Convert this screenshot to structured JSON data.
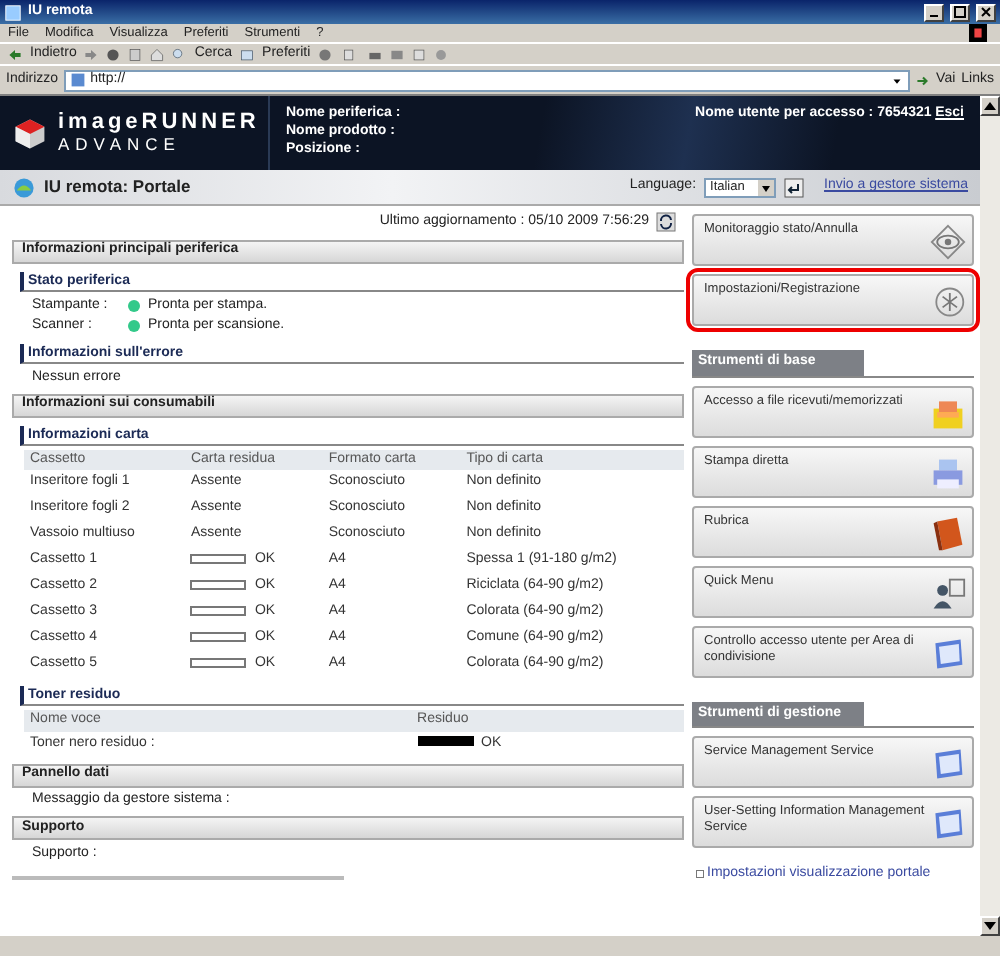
{
  "window": {
    "title": "IU remota"
  },
  "menu": [
    "File",
    "Modifica",
    "Visualizza",
    "Preferiti",
    "Strumenti",
    "?"
  ],
  "toolbar": {
    "back": "Indietro",
    "search": "Cerca",
    "favorites": "Preferiti"
  },
  "address": {
    "label": "Indirizzo",
    "value": "http://",
    "go": "Vai",
    "links": "Links"
  },
  "header": {
    "product": "imageRUNNER",
    "product_line": "ADVANCE",
    "fields": [
      "Nome periferica :",
      "Nome prodotto :",
      "Posizione :"
    ],
    "user": "Nome utente per accesso : 7654321",
    "logout": "Esci"
  },
  "subheader": {
    "title": "IU remota: Portale",
    "language_label": "Language:",
    "language": "Italian",
    "admin_link": "Invio a gestore sistema"
  },
  "last_update": "Ultimo aggiornamento : 05/10 2009 7:56:29",
  "device_info": {
    "title": "Informazioni principali periferica",
    "status": {
      "title": "Stato periferica",
      "items": [
        {
          "label": "Stampante :",
          "text": "Pronta per stampa.",
          "color": "#33c98a"
        },
        {
          "label": "Scanner :",
          "text": "Pronta per scansione.",
          "color": "#33c98a"
        }
      ]
    },
    "errors": {
      "title": "Informazioni sull'errore",
      "text": "Nessun errore"
    }
  },
  "consumables": {
    "title": "Informazioni sui consumabili",
    "paper": {
      "title": "Informazioni carta",
      "columns": [
        "Cassetto",
        "Carta residua",
        "Formato carta",
        "Tipo di carta"
      ],
      "rows": [
        {
          "kind": "text",
          "source": "Inseritore fogli 1",
          "remaining": "Assente",
          "size": "Sconosciuto",
          "type": "Non definito"
        },
        {
          "kind": "text",
          "source": "Inseritore fogli 2",
          "remaining": "Assente",
          "size": "Sconosciuto",
          "type": "Non definito"
        },
        {
          "kind": "text",
          "source": "Vassoio multiuso",
          "remaining": "Assente",
          "size": "Sconosciuto",
          "type": "Non definito"
        },
        {
          "kind": "meter",
          "source": "Cassetto 1",
          "level": 0,
          "remaining": "OK",
          "size": "A4",
          "type": "Spessa 1 (91-180 g/m2)"
        },
        {
          "kind": "meter",
          "source": "Cassetto 2",
          "level": 0,
          "remaining": "OK",
          "size": "A4",
          "type": "Riciclata (64-90 g/m2)"
        },
        {
          "kind": "meter",
          "source": "Cassetto 3",
          "level": 0,
          "remaining": "OK",
          "size": "A4",
          "type": "Colorata (64-90 g/m2)"
        },
        {
          "kind": "meter",
          "source": "Cassetto 4",
          "level": 0,
          "remaining": "OK",
          "size": "A4",
          "type": "Comune (64-90 g/m2)"
        },
        {
          "kind": "meter",
          "source": "Cassetto 5",
          "level": 0,
          "remaining": "OK",
          "size": "A4",
          "type": "Colorata (64-90 g/m2)"
        }
      ]
    },
    "toner": {
      "title": "Toner residuo",
      "columns": [
        "Nome voce",
        "Residuo"
      ],
      "rows": [
        {
          "name": "Toner nero residuo :",
          "level": 1,
          "remaining": "OK"
        }
      ]
    }
  },
  "data_panel": {
    "title": "Pannello dati",
    "text": "Messaggio da gestore sistema :"
  },
  "support": {
    "title": "Supporto",
    "text": "Supporto :"
  },
  "side": {
    "top_buttons": [
      {
        "label": "Monitoraggio stato/Annulla",
        "kind": "eye",
        "highlighted": false
      },
      {
        "label": "Impostazioni/Registrazione",
        "kind": "asterisk",
        "highlighted": true
      }
    ],
    "groups": [
      {
        "title": "Strumenti di base",
        "buttons": [
          {
            "label": "Accesso a file ricevuti/memorizzati",
            "kind": "folder",
            "highlighted": false
          },
          {
            "label": "Stampa diretta",
            "kind": "printer",
            "highlighted": false
          },
          {
            "label": "Rubrica",
            "kind": "book",
            "highlighted": false
          },
          {
            "label": "Quick Menu",
            "kind": "people",
            "highlighted": false
          },
          {
            "label": "Controllo accesso utente per Area di condivisione",
            "kind": "window",
            "highlighted": false
          }
        ]
      },
      {
        "title": "Strumenti di gestione",
        "buttons": [
          {
            "label": "Service Management Service",
            "kind": "window",
            "highlighted": false
          },
          {
            "label": "User-Setting Information Management Service",
            "kind": "window",
            "highlighted": false
          }
        ]
      }
    ],
    "footer_link": "Impostazioni visualizzazione portale"
  }
}
